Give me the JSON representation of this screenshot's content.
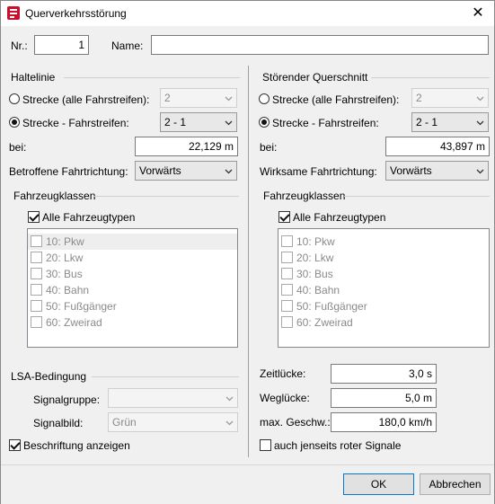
{
  "window": {
    "title": "Querverkehrsstörung"
  },
  "top": {
    "nr_label": "Nr.:",
    "nr_value": "1",
    "name_label": "Name:",
    "name_value": ""
  },
  "left": {
    "group_title": "Haltelinie",
    "radio_all_label": "Strecke (alle Fahrstreifen):",
    "radio_all_value": "2",
    "radio_lane_label": "Strecke - Fahrstreifen:",
    "radio_lane_value": "2 - 1",
    "at_label": "bei:",
    "at_value": "22,129 m",
    "direction_label": "Betroffene Fahrtrichtung:",
    "direction_value": "Vorwärts",
    "vehicle_classes_title": "Fahrzeugklassen",
    "all_types_label": "Alle Fahrzeugtypen",
    "vehicle_types": [
      "10: Pkw",
      "20: Lkw",
      "30: Bus",
      "40: Bahn",
      "50: Fußgänger",
      "60: Zweirad"
    ],
    "lsa_title": "LSA-Bedingung",
    "signal_group_label": "Signalgruppe:",
    "signal_group_value": "",
    "signal_image_label": "Signalbild:",
    "signal_image_value": "Grün",
    "show_label_text": "Beschriftung anzeigen"
  },
  "right": {
    "group_title": "Störender Querschnitt",
    "radio_all_label": "Strecke (alle Fahrstreifen):",
    "radio_all_value": "2",
    "radio_lane_label": "Strecke - Fahrstreifen:",
    "radio_lane_value": "2 - 1",
    "at_label": "bei:",
    "at_value": "43,897 m",
    "direction_label": "Wirksame Fahrtrichtung:",
    "direction_value": "Vorwärts",
    "vehicle_classes_title": "Fahrzeugklassen",
    "all_types_label": "Alle Fahrzeugtypen",
    "vehicle_types": [
      "10: Pkw",
      "20: Lkw",
      "30: Bus",
      "40: Bahn",
      "50: Fußgänger",
      "60: Zweirad"
    ],
    "time_gap_label": "Zeitlücke:",
    "time_gap_value": "3,0 s",
    "distance_gap_label": "Weglücke:",
    "distance_gap_value": "5,0 m",
    "max_speed_label": "max. Geschw.:",
    "max_speed_value": "180,0 km/h",
    "beyond_red_label": "auch jenseits roter Signale"
  },
  "buttons": {
    "ok": "OK",
    "cancel": "Abbrechen"
  }
}
